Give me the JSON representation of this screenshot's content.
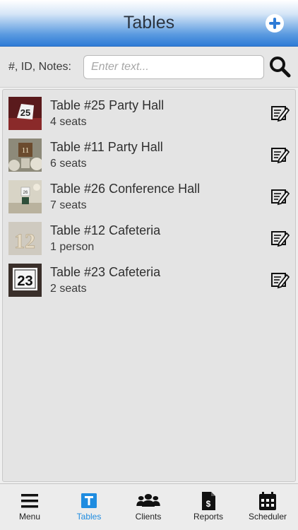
{
  "header": {
    "title": "Tables"
  },
  "search": {
    "label": "#, ID, Notes:",
    "placeholder": "Enter text...",
    "value": ""
  },
  "tables": [
    {
      "title": "Table #25 Party Hall",
      "seats": "4 seats",
      "number": "25"
    },
    {
      "title": "Table #11 Party Hall",
      "seats": "6 seats",
      "number": "11"
    },
    {
      "title": "Table #26 Conference Hall",
      "seats": "7 seats",
      "number": "26"
    },
    {
      "title": "Table #12 Cafeteria",
      "seats": "1 person",
      "number": "12"
    },
    {
      "title": "Table #23 Cafeteria",
      "seats": "2 seats",
      "number": "23"
    }
  ],
  "tabbar": {
    "menu": "Menu",
    "tables": "Tables",
    "clients": "Clients",
    "reports": "Reports",
    "scheduler": "Scheduler",
    "active": "tables"
  },
  "colors": {
    "accent": "#1f8ce0",
    "header_blue": "#2e7bd6"
  }
}
